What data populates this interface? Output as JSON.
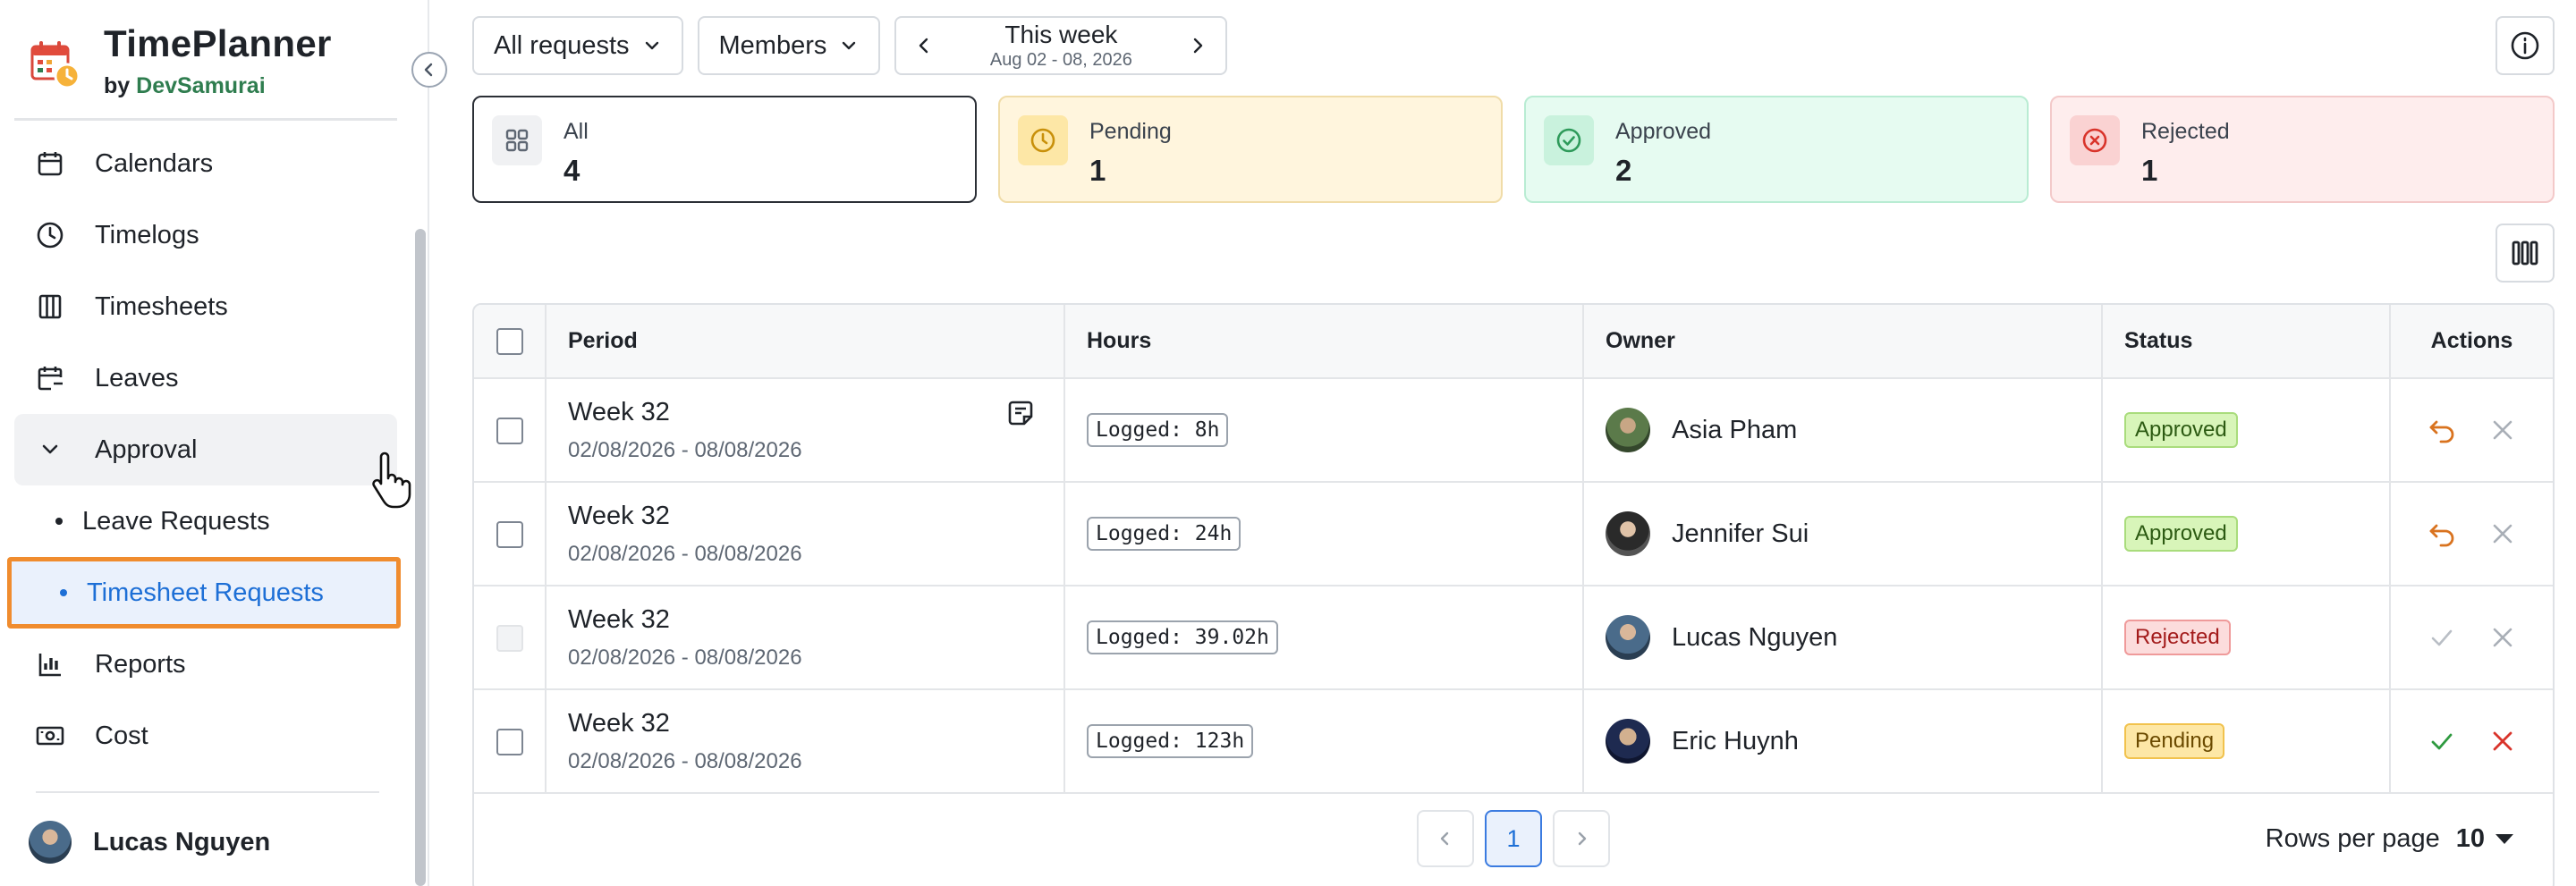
{
  "brand": {
    "title": "TimePlanner",
    "by": "by",
    "company": "DevSamurai"
  },
  "nav": {
    "calendars": "Calendars",
    "timelogs": "Timelogs",
    "timesheets": "Timesheets",
    "leaves": "Leaves",
    "approval": "Approval",
    "leave_requests": "Leave Requests",
    "timesheet_requests": "Timesheet Requests",
    "reports": "Reports",
    "cost": "Cost"
  },
  "user": {
    "name": "Lucas Nguyen"
  },
  "toolbar": {
    "requests_filter": "All requests",
    "members_filter": "Members",
    "week_title": "This week",
    "week_range": "Aug 02 - 08, 2026"
  },
  "cards": {
    "all": {
      "label": "All",
      "count": "4"
    },
    "pending": {
      "label": "Pending",
      "count": "1"
    },
    "approved": {
      "label": "Approved",
      "count": "2"
    },
    "rejected": {
      "label": "Rejected",
      "count": "1"
    }
  },
  "table": {
    "headers": {
      "period": "Period",
      "hours": "Hours",
      "owner": "Owner",
      "status": "Status",
      "actions": "Actions"
    },
    "rows": [
      {
        "period": "Week 32",
        "dates": "02/08/2026 - 08/08/2026",
        "hours": "Logged: 8h",
        "owner": "Asia Pham",
        "status": "Approved"
      },
      {
        "period": "Week 32",
        "dates": "02/08/2026 - 08/08/2026",
        "hours": "Logged: 24h",
        "owner": "Jennifer Sui",
        "status": "Approved"
      },
      {
        "period": "Week 32",
        "dates": "02/08/2026 - 08/08/2026",
        "hours": "Logged: 39.02h",
        "owner": "Lucas Nguyen",
        "status": "Rejected"
      },
      {
        "period": "Week 32",
        "dates": "02/08/2026 - 08/08/2026",
        "hours": "Logged: 123h",
        "owner": "Eric Huynh",
        "status": "Pending"
      }
    ]
  },
  "pagination": {
    "current_page": "1",
    "rows_per_page_label": "Rows per page",
    "rows_per_page": "10"
  },
  "colors": {
    "accent": "#1d6fd6",
    "highlight": "#f08c2e",
    "approve": "#2e9a3f",
    "reject": "#d9342b",
    "revert": "#d9731f"
  }
}
